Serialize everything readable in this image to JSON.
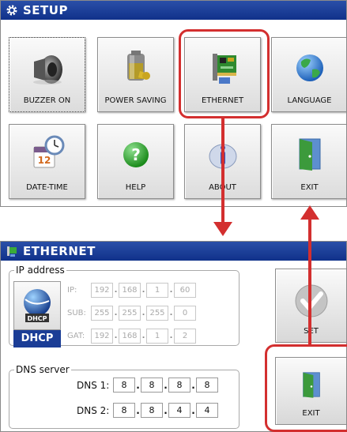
{
  "setup": {
    "title": "SETUP",
    "tiles": [
      {
        "label": "BUZZER ON",
        "icon": "speaker-icon"
      },
      {
        "label": "POWER SAVING",
        "icon": "battery-icon"
      },
      {
        "label": "ETHERNET",
        "icon": "network-card-icon"
      },
      {
        "label": "LANGUAGE",
        "icon": "globe-icon"
      },
      {
        "label": "DATE-TIME",
        "icon": "calendar-clock-icon"
      },
      {
        "label": "HELP",
        "icon": "help-icon"
      },
      {
        "label": "ABOUT",
        "icon": "info-icon"
      },
      {
        "label": "EXIT",
        "icon": "door-icon"
      }
    ],
    "calendar_day": "12"
  },
  "ethernet": {
    "title": "ETHERNET",
    "ip_group_label": "IP address",
    "dhcp_badge": "DHCP",
    "dhcp_button_label": "DHCP",
    "ip": {
      "label": "IP:",
      "octets": [
        "192",
        "168",
        "1",
        "60"
      ]
    },
    "sub": {
      "label": "SUB:",
      "octets": [
        "255",
        "255",
        "255",
        "0"
      ]
    },
    "gat": {
      "label": "GAT:",
      "octets": [
        "192",
        "168",
        "1",
        "2"
      ]
    },
    "dns_group_label": "DNS server",
    "dns1": {
      "label": "DNS 1:",
      "octets": [
        "8",
        "8",
        "8",
        "8"
      ]
    },
    "dns2": {
      "label": "DNS 2:",
      "octets": [
        "8",
        "8",
        "4",
        "4"
      ]
    },
    "set_label": "SET",
    "exit_label": "EXIT"
  },
  "colors": {
    "highlight": "#d32f2f",
    "titlebar": "#1b3d96"
  }
}
